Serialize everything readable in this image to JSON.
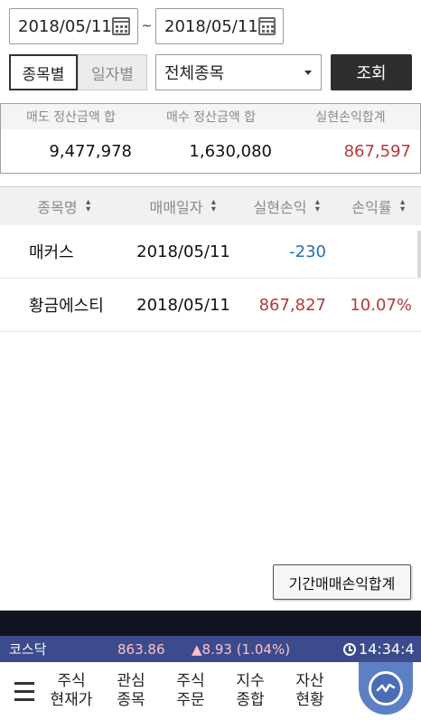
{
  "dates": {
    "start": "2018/05/11",
    "end": "2018/05/11",
    "separator": "~"
  },
  "filter": {
    "seg_by_stock": "종목별",
    "seg_by_date": "일자별",
    "stock_select": "전체종목",
    "query_label": "조회"
  },
  "summary": {
    "headers": [
      "매도 정산금액 합",
      "매수 정산금액 합",
      "실현손익합계"
    ],
    "values": [
      "9,477,978",
      "1,630,080",
      "867,597"
    ]
  },
  "table": {
    "headers": [
      "종목명",
      "매매일자",
      "실현손익",
      "손익률"
    ],
    "rows": [
      {
        "name": "매커스",
        "date": "2018/05/11",
        "pnl": "-230",
        "rate": ""
      },
      {
        "name": "황금에스티",
        "date": "2018/05/11",
        "pnl": "867,827",
        "rate": "10.07%"
      }
    ]
  },
  "period_button": "기간매매손익합계",
  "ticker": {
    "name": "코스닥",
    "value": "863.86",
    "change": "▲8.93 (1.04%)",
    "time": "14:34:4"
  },
  "nav": [
    {
      "l1": "주식",
      "l2": "현재가"
    },
    {
      "l1": "관심",
      "l2": "종목"
    },
    {
      "l1": "주식",
      "l2": "주문"
    },
    {
      "l1": "지수",
      "l2": "종합"
    },
    {
      "l1": "자산",
      "l2": "현황"
    }
  ],
  "colors": {
    "loss": "#1f6fb5",
    "gain": "#b23a3a",
    "ticker_bg": "#3c4b8c",
    "fab": "#5d80c4"
  }
}
